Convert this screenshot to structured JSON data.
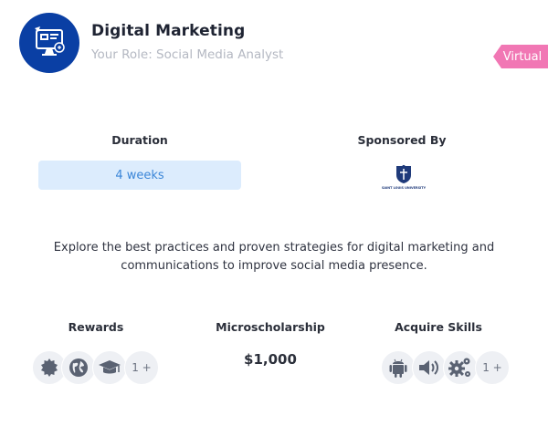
{
  "program": {
    "title": "Digital Marketing",
    "role": "Your Role: Social Media Analyst",
    "mode_badge": "Virtual",
    "description": "Explore the best practices and proven strategies for digital marketing and communications to improve social media presence."
  },
  "duration": {
    "label": "Duration",
    "value": "4 weeks"
  },
  "sponsor": {
    "label": "Sponsored By",
    "logo_text": "SAINT LOUIS UNIVERSITY"
  },
  "rewards": {
    "label": "Rewards",
    "icons": [
      "badge-icon",
      "globe-icon",
      "graduation-cap-icon"
    ],
    "more": "1 +"
  },
  "microscholarship": {
    "label": "Microscholarship",
    "value": "$1,000"
  },
  "skills": {
    "label": "Acquire Skills",
    "icons": [
      "android-icon",
      "speaker-icon",
      "gears-icon"
    ],
    "more": "1 +"
  },
  "colors": {
    "brand_blue": "#0a3fa4",
    "badge_pink": "#f177b4",
    "duration_bg": "#dcecfd",
    "duration_text": "#3b86d8"
  }
}
